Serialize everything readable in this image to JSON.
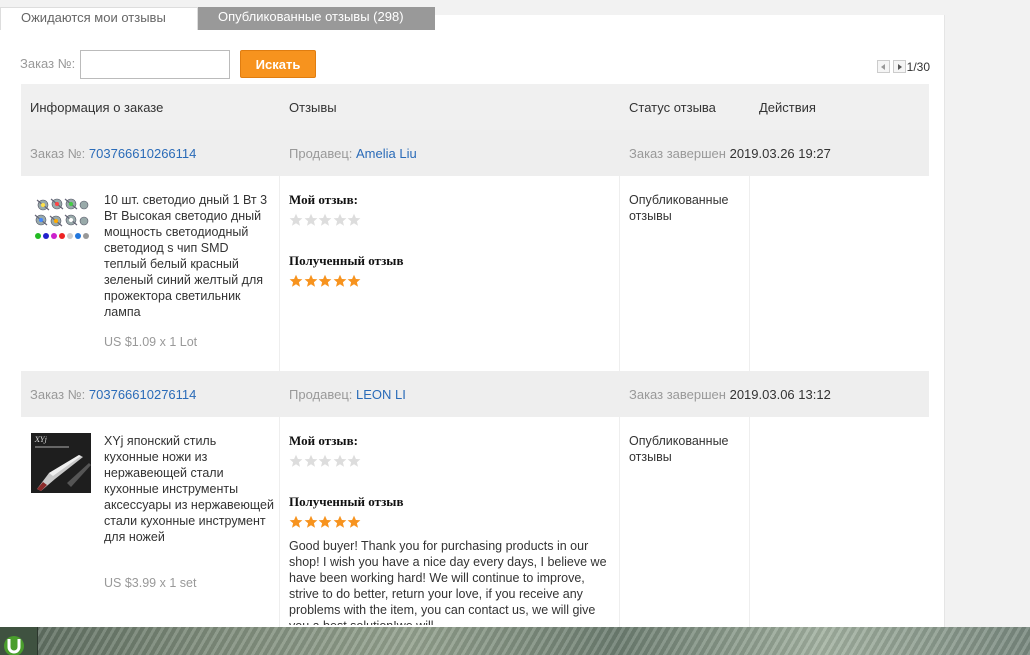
{
  "tabs": {
    "pending": "Ожидаются мои отзывы",
    "published": "Опубликованные отзывы (298)"
  },
  "search": {
    "label": "Заказ №:",
    "value": "",
    "placeholder": "",
    "button": "Искать"
  },
  "pager": {
    "text": "1/30"
  },
  "table": {
    "headers": [
      "Информация о заказе",
      "Отзывы",
      "Статус отзыва",
      "Действия"
    ]
  },
  "orders": [
    {
      "order_label": "Заказ №:",
      "order_number": "703766610266114",
      "seller_label": "Продавец:",
      "seller_name": "Amelia Liu",
      "completed_label": "Заказ завершен",
      "completed_date": "2019.03.26 19:27",
      "product_title": "10 шт. светодио дный 1 Вт 3 Вт Высокая светодио дный мощность светодиодный светодиод s чип SMD теплый белый красный зеленый синий желтый для прожектора светильник лампа",
      "price": "US $1.09 x 1 Lot",
      "my_review_label": "Мой отзыв:",
      "my_rating": 0,
      "received_label": "Полученный отзыв",
      "received_rating": 5,
      "received_text": "",
      "status": "Опубликованные отзывы"
    },
    {
      "order_label": "Заказ №:",
      "order_number": "703766610276114",
      "seller_label": "Продавец:",
      "seller_name": "LEON LI",
      "completed_label": "Заказ завершен",
      "completed_date": "2019.03.06 13:12",
      "product_title": "XYj японский стиль кухонные ножи из нержавеющей стали кухонные инструменты аксессуары из нержавеющей стали кухонные инструмент для ножей",
      "price": "US $3.99 x 1 set",
      "my_review_label": "Мой отзыв:",
      "my_rating": 0,
      "received_label": "Полученный отзыв",
      "received_rating": 5,
      "received_text": "Good buyer! Thank you for purchasing products in our shop! I wish you have a nice day every days, I believe we have been working hard! We will continue to improve, strive to do better, return your love, if you receive any problems with the item, you can contact us, we will give you a best solution!we will",
      "status": "Опубликованные отзывы"
    }
  ],
  "colors": {
    "accent": "#f7931e",
    "link": "#2a6bb8",
    "star_filled": "#f7931e",
    "star_empty": "#dddddd"
  },
  "taskbar": {
    "icon": "utorrent-icon"
  }
}
